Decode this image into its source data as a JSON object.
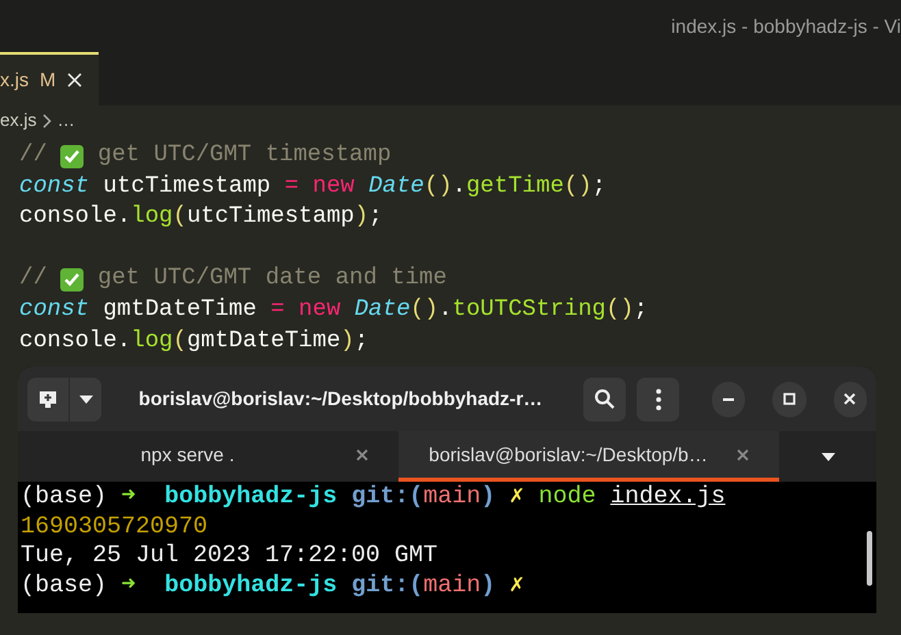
{
  "window": {
    "title": "index.js - bobbyhadz-js - Vi"
  },
  "editor_tab": {
    "label": "x.js",
    "badge": "M",
    "selected": true
  },
  "breadcrumb": [
    "ex.js",
    "…"
  ],
  "code_lines": [
    {
      "gap_before": false,
      "tokens": [
        {
          "kind": "comment",
          "text": "//"
        },
        {
          "kind": "check"
        },
        {
          "kind": "comment",
          "text": "get UTC/GMT timestamp"
        }
      ]
    },
    {
      "gap_before": false,
      "tokens": [
        {
          "kind": "keyword",
          "text": "const"
        },
        {
          "kind": "plain",
          "text": " utcTimestamp "
        },
        {
          "kind": "op",
          "text": "="
        },
        {
          "kind": "new",
          "text": " new "
        },
        {
          "kind": "class",
          "text": "Date"
        },
        {
          "kind": "paren",
          "text": "()"
        },
        {
          "kind": "plain",
          "text": "."
        },
        {
          "kind": "func",
          "text": "getTime"
        },
        {
          "kind": "paren",
          "text": "()"
        },
        {
          "kind": "plain",
          "text": ";"
        }
      ]
    },
    {
      "gap_before": false,
      "tokens": [
        {
          "kind": "plain",
          "text": "console."
        },
        {
          "kind": "func",
          "text": "log"
        },
        {
          "kind": "paren",
          "text": "("
        },
        {
          "kind": "plain",
          "text": "utcTimestamp"
        },
        {
          "kind": "paren",
          "text": ")"
        },
        {
          "kind": "plain",
          "text": ";"
        }
      ]
    },
    {
      "gap_before": true,
      "tokens": [
        {
          "kind": "comment",
          "text": "//"
        },
        {
          "kind": "check"
        },
        {
          "kind": "comment",
          "text": "get UTC/GMT date and time"
        }
      ]
    },
    {
      "gap_before": false,
      "tokens": [
        {
          "kind": "keyword",
          "text": "const"
        },
        {
          "kind": "plain",
          "text": " gmtDateTime "
        },
        {
          "kind": "op",
          "text": "="
        },
        {
          "kind": "new",
          "text": " new "
        },
        {
          "kind": "class",
          "text": "Date"
        },
        {
          "kind": "paren",
          "text": "()"
        },
        {
          "kind": "plain",
          "text": "."
        },
        {
          "kind": "func",
          "text": "toUTCString"
        },
        {
          "kind": "paren",
          "text": "()"
        },
        {
          "kind": "plain",
          "text": ";"
        }
      ]
    },
    {
      "gap_before": false,
      "tokens": [
        {
          "kind": "plain",
          "text": "console."
        },
        {
          "kind": "func",
          "text": "log"
        },
        {
          "kind": "paren",
          "text": "("
        },
        {
          "kind": "plain",
          "text": "gmtDateTime"
        },
        {
          "kind": "paren",
          "text": ")"
        },
        {
          "kind": "plain",
          "text": ";"
        }
      ]
    }
  ],
  "terminal": {
    "title": "borislav@borislav:~/Desktop/bobbyhadz-r…",
    "tabs": [
      {
        "label": "npx serve .",
        "selected": false
      },
      {
        "label": "borislav@borislav:~/Desktop/b…",
        "selected": true
      }
    ],
    "lines": [
      [
        {
          "kind": "plain",
          "text": "(base) "
        },
        {
          "kind": "arrow",
          "text": "➜"
        },
        {
          "kind": "dir",
          "text": "  bobbyhadz-js "
        },
        {
          "kind": "git",
          "text": "git:("
        },
        {
          "kind": "branch",
          "text": "main"
        },
        {
          "kind": "git",
          "text": ")"
        },
        {
          "kind": "dirty",
          "text": " ✗ "
        },
        {
          "kind": "cmd",
          "text": "node "
        },
        {
          "kind": "link",
          "text": "index.js"
        }
      ],
      [
        {
          "kind": "number",
          "text": "1690305720970"
        }
      ],
      [
        {
          "kind": "plain",
          "text": "Tue, 25 Jul 2023 17:22:00 GMT"
        }
      ],
      [
        {
          "kind": "plain",
          "text": "(base) "
        },
        {
          "kind": "arrow",
          "text": "➜"
        },
        {
          "kind": "dir",
          "text": "  bobbyhadz-js "
        },
        {
          "kind": "git",
          "text": "git:("
        },
        {
          "kind": "branch",
          "text": "main"
        },
        {
          "kind": "git",
          "text": ")"
        },
        {
          "kind": "dirty",
          "text": " ✗"
        }
      ]
    ]
  }
}
